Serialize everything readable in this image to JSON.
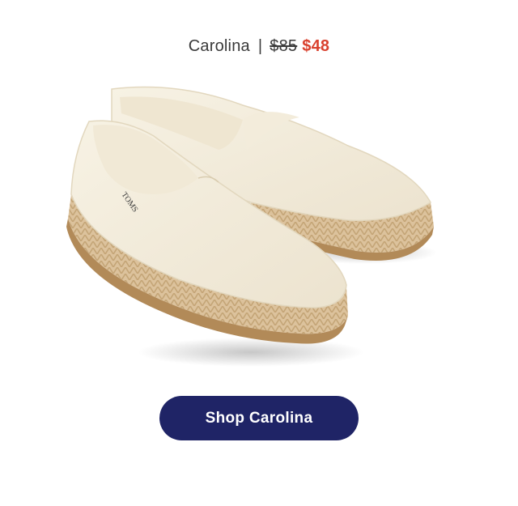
{
  "product": {
    "name": "Carolina",
    "separator": "|",
    "original_price": "$85",
    "sale_price": "$48"
  },
  "image": {
    "description_icon": "espadrille-shoes-image"
  },
  "cta": {
    "label": "Shop Carolina"
  },
  "colors": {
    "button_bg": "#1f2466",
    "sale_price": "#d9412e",
    "text": "#3a3a3a"
  }
}
